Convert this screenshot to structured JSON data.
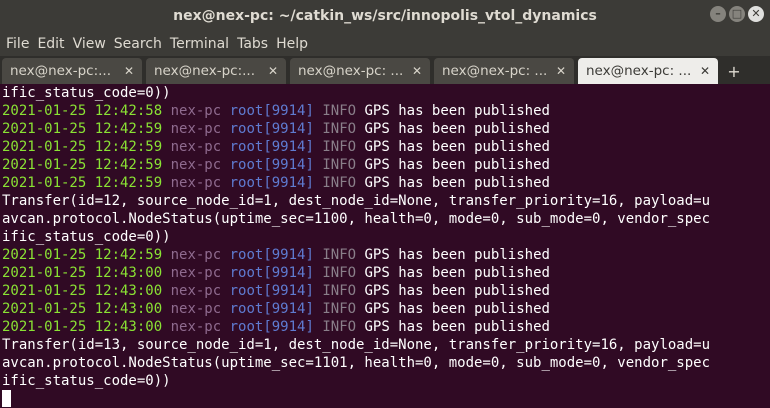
{
  "window": {
    "title": "nex@nex-pc: ~/catkin_ws/src/innopolis_vtol_dynamics"
  },
  "menu": [
    "File",
    "Edit",
    "View",
    "Search",
    "Terminal",
    "Tabs",
    "Help"
  ],
  "tabs": [
    {
      "label": "nex@nex-pc:...",
      "close": "✕"
    },
    {
      "label": "nex@nex-pc:...",
      "close": "✕"
    },
    {
      "label": "nex@nex-pc: ...",
      "close": "✕"
    },
    {
      "label": "nex@nex-pc: ...",
      "close": "✕"
    },
    {
      "label": "nex@nex-pc: ...",
      "close": "✕"
    }
  ],
  "new_tab_icon": "+",
  "colors": {
    "terminal_bg": "#300a24",
    "timestamp": "#8ae234"
  },
  "terminal": {
    "lines": [
      {
        "type": "text",
        "text": "ific_status_code=0))"
      },
      {
        "type": "log",
        "ts": "2021-01-25 12:42:58",
        "host": "nex-pc",
        "user": "root[9914]",
        "level": "INFO",
        "msg": "GPS has been published"
      },
      {
        "type": "log",
        "ts": "2021-01-25 12:42:59",
        "host": "nex-pc",
        "user": "root[9914]",
        "level": "INFO",
        "msg": "GPS has been published"
      },
      {
        "type": "log",
        "ts": "2021-01-25 12:42:59",
        "host": "nex-pc",
        "user": "root[9914]",
        "level": "INFO",
        "msg": "GPS has been published"
      },
      {
        "type": "log",
        "ts": "2021-01-25 12:42:59",
        "host": "nex-pc",
        "user": "root[9914]",
        "level": "INFO",
        "msg": "GPS has been published"
      },
      {
        "type": "log",
        "ts": "2021-01-25 12:42:59",
        "host": "nex-pc",
        "user": "root[9914]",
        "level": "INFO",
        "msg": "GPS has been published"
      },
      {
        "type": "text",
        "text": "Transfer(id=12, source_node_id=1, dest_node_id=None, transfer_priority=16, payload=u"
      },
      {
        "type": "text",
        "text": "avcan.protocol.NodeStatus(uptime_sec=1100, health=0, mode=0, sub_mode=0, vendor_spec"
      },
      {
        "type": "text",
        "text": "ific_status_code=0))"
      },
      {
        "type": "log",
        "ts": "2021-01-25 12:42:59",
        "host": "nex-pc",
        "user": "root[9914]",
        "level": "INFO",
        "msg": "GPS has been published"
      },
      {
        "type": "log",
        "ts": "2021-01-25 12:43:00",
        "host": "nex-pc",
        "user": "root[9914]",
        "level": "INFO",
        "msg": "GPS has been published"
      },
      {
        "type": "log",
        "ts": "2021-01-25 12:43:00",
        "host": "nex-pc",
        "user": "root[9914]",
        "level": "INFO",
        "msg": "GPS has been published"
      },
      {
        "type": "log",
        "ts": "2021-01-25 12:43:00",
        "host": "nex-pc",
        "user": "root[9914]",
        "level": "INFO",
        "msg": "GPS has been published"
      },
      {
        "type": "log",
        "ts": "2021-01-25 12:43:00",
        "host": "nex-pc",
        "user": "root[9914]",
        "level": "INFO",
        "msg": "GPS has been published"
      },
      {
        "type": "text",
        "text": "Transfer(id=13, source_node_id=1, dest_node_id=None, transfer_priority=16, payload=u"
      },
      {
        "type": "text",
        "text": "avcan.protocol.NodeStatus(uptime_sec=1101, health=0, mode=0, sub_mode=0, vendor_spec"
      },
      {
        "type": "text",
        "text": "ific_status_code=0))"
      }
    ]
  }
}
